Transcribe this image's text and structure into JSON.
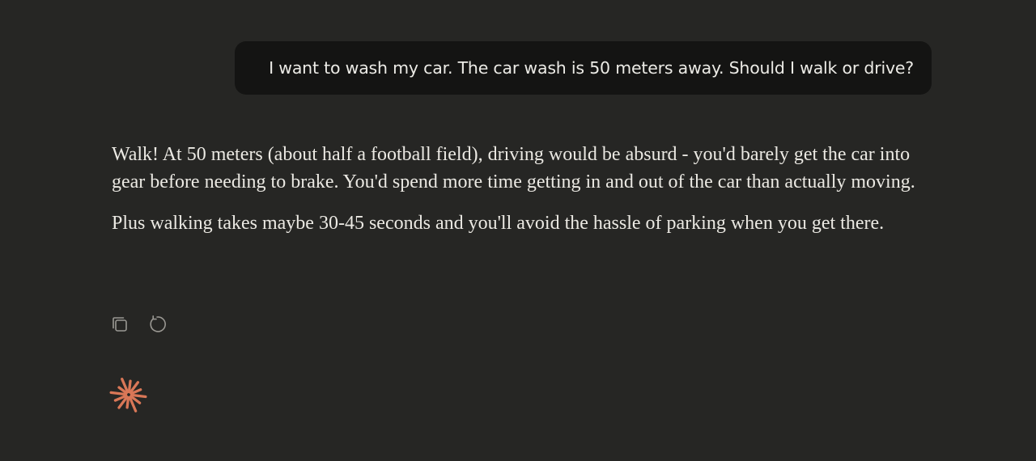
{
  "conversation": {
    "user_message": "I want to wash my car. The car wash is 50 meters away. Should I walk or drive?",
    "assistant_paragraphs": [
      "Walk! At 50 meters (about half a football field), driving would be absurd - you'd barely get the car into gear before needing to brake. You'd spend more time getting in and out of the car than actually moving.",
      "Plus walking takes maybe 30-45 seconds and you'll avoid the hassle of parking when you get there."
    ]
  },
  "actions": {
    "copy_icon": "copy-icon",
    "retry_icon": "retry-icon"
  },
  "logo": {
    "icon": "spark-logo-icon",
    "color": "#D97757"
  },
  "colors": {
    "background": "#262624",
    "user_bubble": "#141413",
    "text": "#ECEBE6",
    "icon": "#9A9893"
  }
}
